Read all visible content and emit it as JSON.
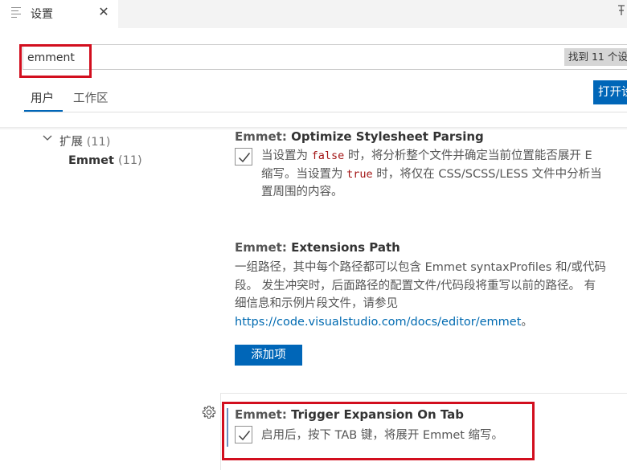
{
  "tab": {
    "icon": "settings-file-icon",
    "title": "设置",
    "close_glyph": "✕",
    "right_icon": "split-editor-icon"
  },
  "search": {
    "value": "emment",
    "placeholder": "搜索设置",
    "found": "找到 11 个设"
  },
  "scope": {
    "tabs": [
      {
        "label": "用户",
        "active": true
      },
      {
        "label": "工作区",
        "active": false
      }
    ],
    "open_json_label": "打开设"
  },
  "toc": {
    "extensions_label": "扩展",
    "extensions_count": "(11)",
    "emmet_label": "Emmet",
    "emmet_count": "(11)"
  },
  "settings": [
    {
      "category": "Emmet: ",
      "name": "Optimize Stylesheet Parsing",
      "checked": true,
      "desc": {
        "l1_a": "当设置为 ",
        "l1_code": "false",
        "l1_b": " 时，将分析整个文件并确定当前位置能否展开 E",
        "l2_a": "缩写。当设置为 ",
        "l2_code": "true",
        "l2_b": " 时，将仅在 CSS/SCSS/LESS 文件中分析当",
        "l3": "置周围的内容。"
      }
    },
    {
      "category": "Emmet: ",
      "name": "Extensions Path",
      "desc": {
        "l1": "一组路径，其中每个路径都可以包含 Emmet syntaxProfiles 和/或代码",
        "l2": "段。 发生冲突时，后面路径的配置文件/代码段将重写以前的路径。 有",
        "l3": "细信息和示例片段文件，请参见",
        "link": "https://code.visualstudio.com/docs/editor/emmet",
        "link_suffix": "。"
      },
      "button_label": "添加项"
    },
    {
      "category": "Emmet: ",
      "name": "Trigger Expansion On Tab",
      "checked": true,
      "desc": "启用后，按下 TAB 键，将展开 Emmet 缩写。"
    }
  ],
  "colors": {
    "accent": "#0066b8",
    "highlight_box": "#d20e1e",
    "link": "#006ab1"
  }
}
